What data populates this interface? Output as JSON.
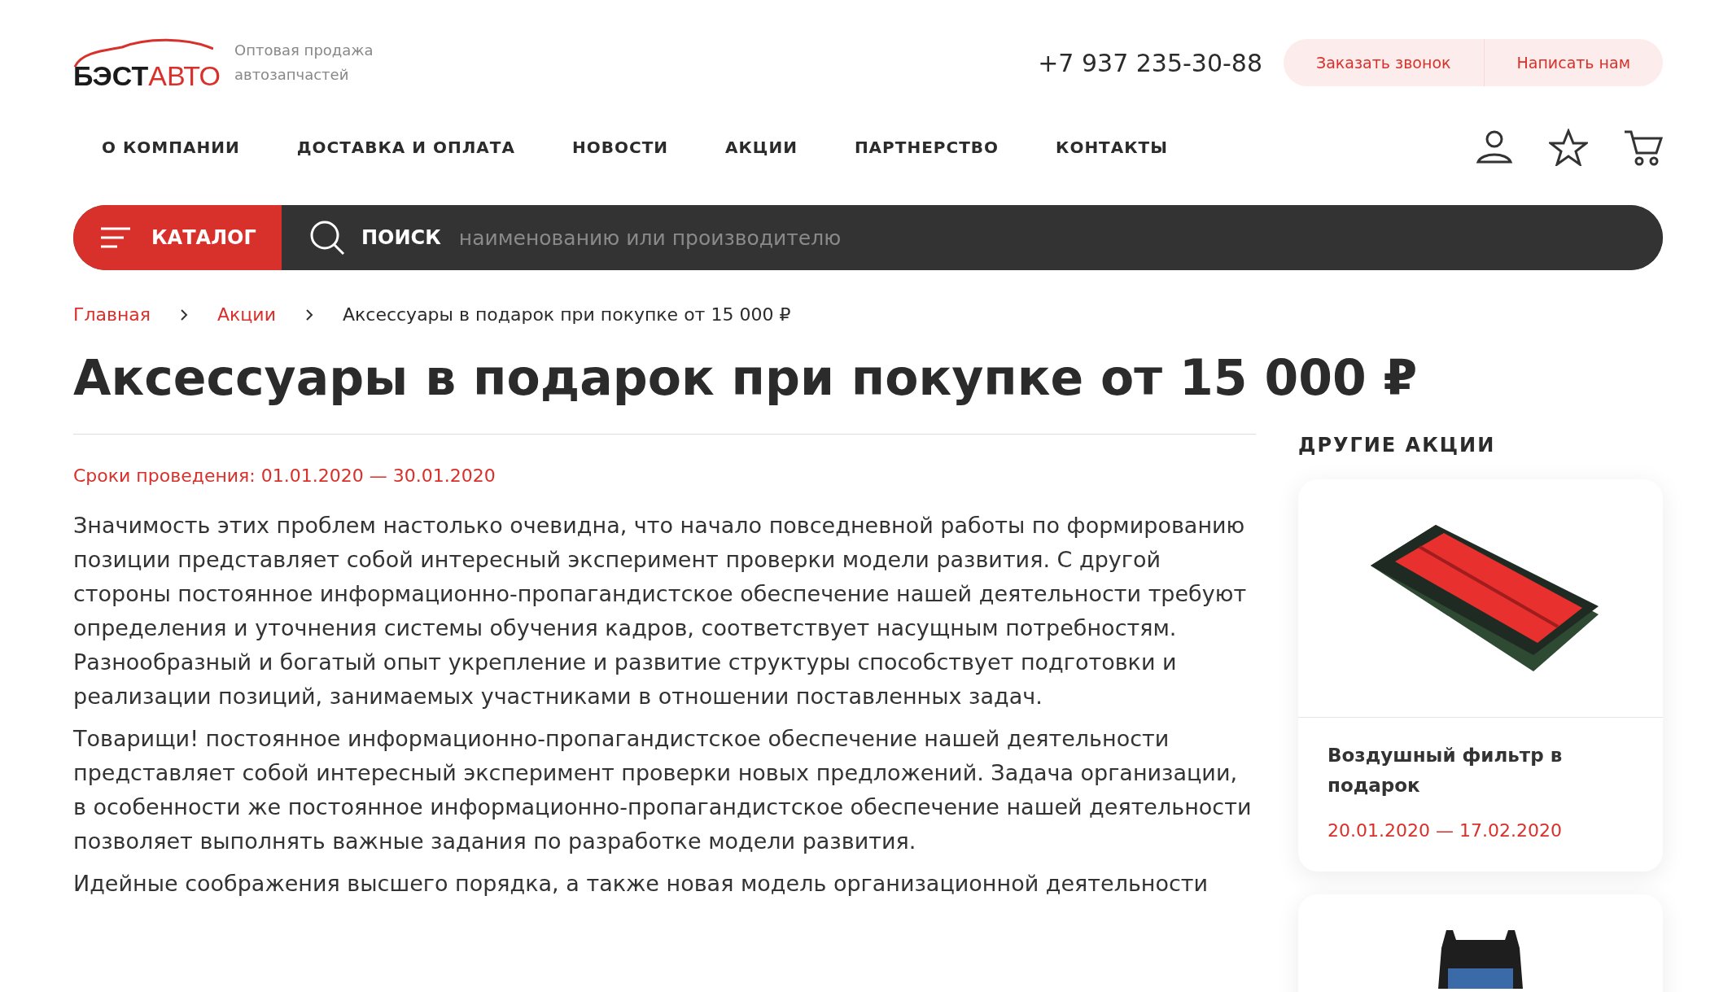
{
  "header": {
    "logo": {
      "dark": "БЭСТ",
      "red": "АВТО"
    },
    "tagline": "Оптовая продажа автозапчастей",
    "phone": "+7 937 235-30-88",
    "actions": [
      "Заказать звонок",
      "Написать нам"
    ]
  },
  "nav": {
    "items": [
      "О КОМПАНИИ",
      "ДОСТАВКА И ОПЛАТА",
      "НОВОСТИ",
      "АКЦИИ",
      "ПАРТНЕРСТВО",
      "КОНТАКТЫ"
    ]
  },
  "search": {
    "catalog": "КАТАЛОГ",
    "label": "ПОИСК",
    "placeholder": "наименованию или производителю"
  },
  "breadcrumbs": [
    {
      "label": "Главная",
      "kind": "link"
    },
    {
      "label": "Акции",
      "kind": "link"
    },
    {
      "label": "Аксессуары в подарок при покупке от 15 000 ₽",
      "kind": "current"
    }
  ],
  "title": "Аксессуары в подарок при покупке от 15 000 ₽",
  "period": "Сроки проведения: 01.01.2020 — 30.01.2020",
  "paragraphs": [
    "Значимость этих проблем настолько очевидна, что начало повседневной работы по формированию позиции представляет собой интересный эксперимент проверки модели развития. С другой стороны постоянное информационно-пропагандистское обеспечение нашей деятельности требуют определения и уточнения системы обучения кадров, соответствует насущным потребностям. Разнообразный и богатый опыт укрепление и развитие структуры способствует подготовки и реализации позиций, занимаемых участниками в отношении поставленных задач.",
    "Товарищи! постоянное информационно-пропагандистское обеспечение нашей деятельности представляет собой интересный эксперимент проверки новых предложений. Задача организации, в особенности же постоянное информационно-пропагандистское обеспечение нашей деятельности позволяет выполнять важные задания по разработке модели развития.",
    "Идейные соображения высшего порядка, а также новая модель организационной деятельности"
  ],
  "sidebar": {
    "title": "ДРУГИЕ АКЦИИ",
    "cards": [
      {
        "kind": "filter",
        "name": "Воздушный фильтр в подарок",
        "dates": "20.01.2020 — 17.02.2020"
      },
      {
        "kind": "bag"
      }
    ]
  }
}
